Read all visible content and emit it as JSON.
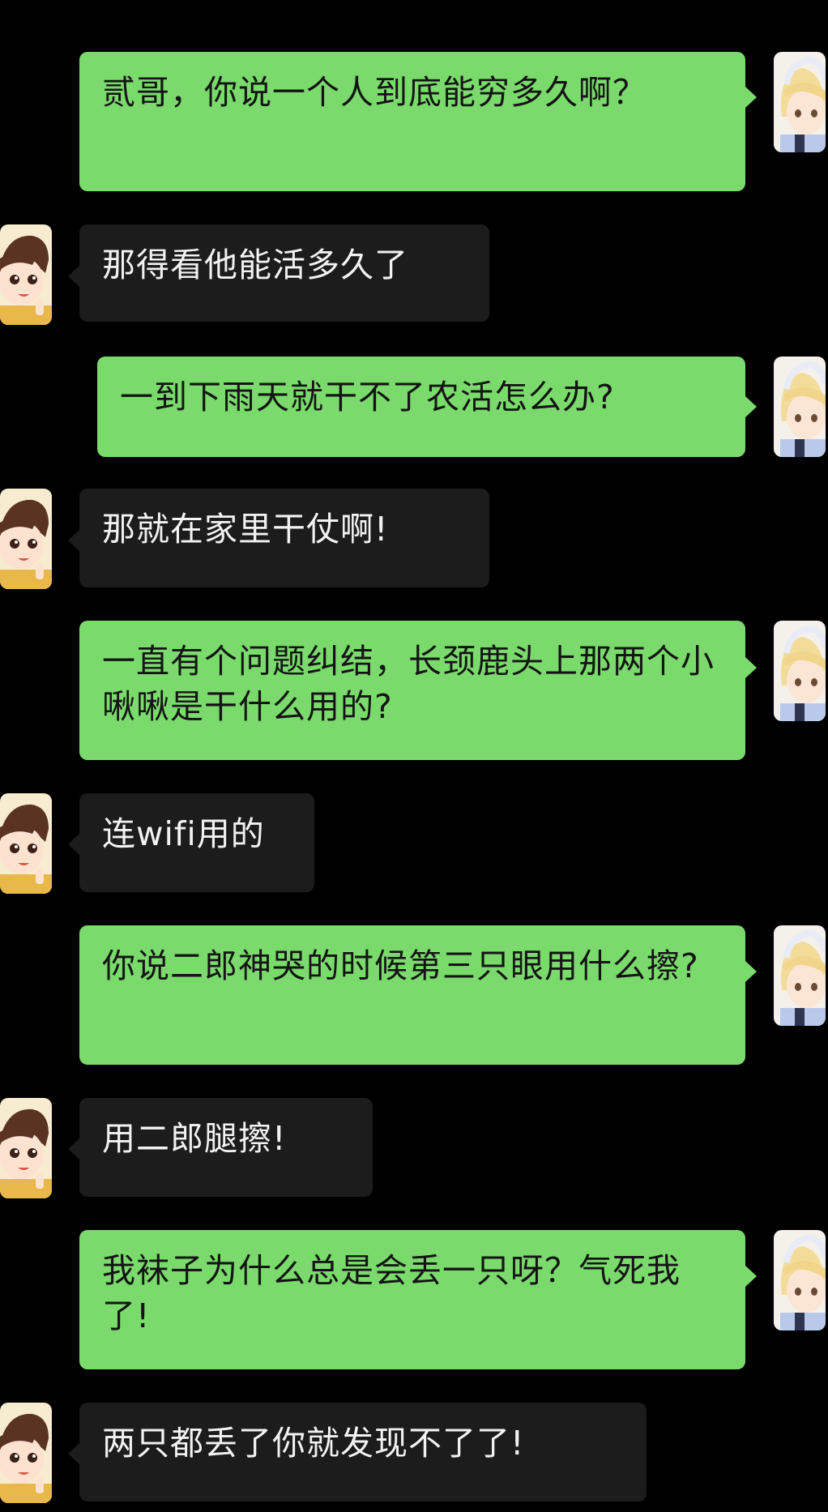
{
  "colors": {
    "background": "#000000",
    "sent_bubble": "#7ada6c",
    "received_bubble": "#1c1c1c",
    "sent_text": "#141414",
    "received_text": "#f2f2f2"
  },
  "avatars": {
    "self": "blonde-anime-character-avatar",
    "other": "cartoon-boy-avatar"
  },
  "messages": [
    {
      "from": "self",
      "text": "贰哥，你说一个人到底能穷多久啊？"
    },
    {
      "from": "other",
      "text": "那得看他能活多久了"
    },
    {
      "from": "self",
      "text": "一到下雨天就干不了农活怎么办?"
    },
    {
      "from": "other",
      "text": "那就在家里干仗啊!"
    },
    {
      "from": "self",
      "text": "一直有个问题纠结，长颈鹿头上那两个小啾啾是干什么用的?"
    },
    {
      "from": "other",
      "text": "连wifi用的"
    },
    {
      "from": "self",
      "text": "你说二郎神哭的时候第三只眼用什么擦?"
    },
    {
      "from": "other",
      "text": "用二郎腿擦!"
    },
    {
      "from": "self",
      "text": "我袜子为什么总是会丢一只呀？气死我了!"
    },
    {
      "from": "other",
      "text": "两只都丢了你就发现不了了!"
    }
  ]
}
